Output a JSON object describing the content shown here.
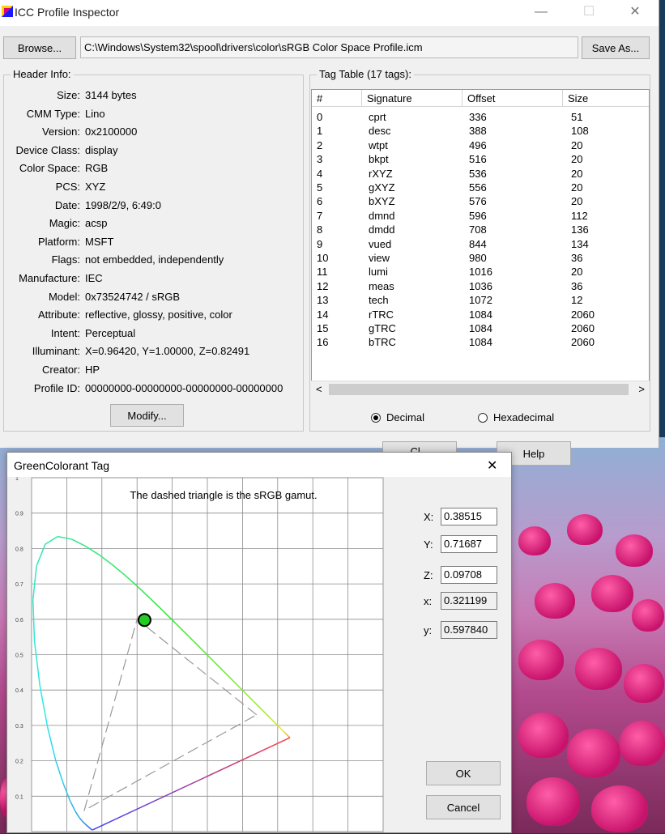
{
  "window": {
    "title": "ICC Profile Inspector",
    "minimize": "—",
    "maximize": "☐",
    "close": "✕"
  },
  "toolbar": {
    "browse_label": "Browse...",
    "path_value": "C:\\Windows\\System32\\spool\\drivers\\color\\sRGB Color Space Profile.icm",
    "save_as_label": "Save As..."
  },
  "header_info": {
    "label": "Header Info:",
    "fields": [
      {
        "key": "Size:",
        "value": "3144 bytes"
      },
      {
        "key": "CMM Type:",
        "value": "Lino"
      },
      {
        "key": "Version:",
        "value": "0x2100000"
      },
      {
        "key": "Device Class:",
        "value": "display"
      },
      {
        "key": "Color Space:",
        "value": "RGB"
      },
      {
        "key": "PCS:",
        "value": "XYZ"
      },
      {
        "key": "Date:",
        "value": "1998/2/9, 6:49:0"
      },
      {
        "key": "Magic:",
        "value": "acsp"
      },
      {
        "key": "Platform:",
        "value": "MSFT"
      },
      {
        "key": "Flags:",
        "value": "not embedded, independently"
      },
      {
        "key": "Manufacture:",
        "value": "IEC"
      },
      {
        "key": "Model:",
        "value": "0x73524742 / sRGB"
      },
      {
        "key": "Attribute:",
        "value": "reflective, glossy, positive, color"
      },
      {
        "key": "Intent:",
        "value": "Perceptual"
      },
      {
        "key": "Illuminant:",
        "value": "X=0.96420, Y=1.00000, Z=0.82491"
      },
      {
        "key": "Creator:",
        "value": "HP"
      },
      {
        "key": "Profile ID:",
        "value": "00000000-00000000-00000000-00000000"
      }
    ],
    "modify_label": "Modify..."
  },
  "tag_table": {
    "label": "Tag Table (17 tags):",
    "columns": [
      "#",
      "Signature",
      "Offset",
      "Size"
    ],
    "rows": [
      [
        "0",
        "cprt",
        "336",
        "51"
      ],
      [
        "1",
        "desc",
        "388",
        "108"
      ],
      [
        "2",
        "wtpt",
        "496",
        "20"
      ],
      [
        "3",
        "bkpt",
        "516",
        "20"
      ],
      [
        "4",
        "rXYZ",
        "536",
        "20"
      ],
      [
        "5",
        "gXYZ",
        "556",
        "20"
      ],
      [
        "6",
        "bXYZ",
        "576",
        "20"
      ],
      [
        "7",
        "dmnd",
        "596",
        "112"
      ],
      [
        "8",
        "dmdd",
        "708",
        "136"
      ],
      [
        "9",
        "vued",
        "844",
        "134"
      ],
      [
        "10",
        "view",
        "980",
        "36"
      ],
      [
        "11",
        "lumi",
        "1016",
        "20"
      ],
      [
        "12",
        "meas",
        "1036",
        "36"
      ],
      [
        "13",
        "tech",
        "1072",
        "12"
      ],
      [
        "14",
        "rTRC",
        "1084",
        "2060"
      ],
      [
        "15",
        "gTRC",
        "1084",
        "2060"
      ],
      [
        "16",
        "bTRC",
        "1084",
        "2060"
      ]
    ],
    "scroll_left": "<",
    "scroll_right": ">",
    "radio_decimal": "Decimal",
    "radio_hex": "Hexadecimal",
    "selected_radio": "decimal"
  },
  "bottom_buttons": {
    "close_partial": "Cl...",
    "help_label": "Help"
  },
  "dialog": {
    "title": "GreenColorant Tag",
    "close": "✕",
    "chart_note": "The dashed triangle is the sRGB gamut.",
    "fields": [
      {
        "key": "X:",
        "value": "0.38515",
        "readonly": false
      },
      {
        "key": "Y:",
        "value": "0.71687",
        "readonly": false
      },
      {
        "key": "Z:",
        "value": "0.09708",
        "readonly": false
      },
      {
        "key": "x:",
        "value": "0.321199",
        "readonly": true
      },
      {
        "key": "y:",
        "value": "0.597840",
        "readonly": true
      }
    ],
    "ok_label": "OK",
    "cancel_label": "Cancel"
  },
  "chart_data": {
    "type": "scatter",
    "title": "The dashed triangle is the sRGB gamut.",
    "xlim": [
      0,
      1
    ],
    "ylim": [
      0,
      1
    ],
    "x_ticks": [
      "0.1",
      "0.2",
      "0.3",
      "0.4",
      "0.5",
      "0.6",
      "0.7",
      "0.8",
      "0.9"
    ],
    "y_ticks": [
      "0.1",
      "0.2",
      "0.3",
      "0.4",
      "0.5",
      "0.6",
      "0.7",
      "0.8",
      "0.9",
      "1"
    ],
    "grid": true,
    "point": {
      "x": 0.321199,
      "y": 0.59784,
      "color": "#22cc22"
    },
    "srgb_gamut": [
      [
        0.64,
        0.33
      ],
      [
        0.3,
        0.6
      ],
      [
        0.15,
        0.06
      ]
    ],
    "spectral_locus": [
      [
        0.1741,
        0.005
      ],
      [
        0.1738,
        0.0049
      ],
      [
        0.1736,
        0.0049
      ],
      [
        0.1733,
        0.0048
      ],
      [
        0.173,
        0.0048
      ],
      [
        0.1726,
        0.0048
      ],
      [
        0.1721,
        0.0048
      ],
      [
        0.1714,
        0.0051
      ],
      [
        0.1703,
        0.0058
      ],
      [
        0.1689,
        0.0069
      ],
      [
        0.1669,
        0.0086
      ],
      [
        0.1644,
        0.0109
      ],
      [
        0.1611,
        0.0138
      ],
      [
        0.1566,
        0.0177
      ],
      [
        0.151,
        0.0227
      ],
      [
        0.144,
        0.0297
      ],
      [
        0.1355,
        0.0399
      ],
      [
        0.1241,
        0.0578
      ],
      [
        0.1096,
        0.0868
      ],
      [
        0.0913,
        0.1327
      ],
      [
        0.0687,
        0.2007
      ],
      [
        0.0454,
        0.295
      ],
      [
        0.0235,
        0.4127
      ],
      [
        0.0082,
        0.5384
      ],
      [
        0.0039,
        0.6548
      ],
      [
        0.0139,
        0.7502
      ],
      [
        0.0389,
        0.812
      ],
      [
        0.0743,
        0.8338
      ],
      [
        0.1142,
        0.8262
      ],
      [
        0.1547,
        0.8059
      ],
      [
        0.1929,
        0.7816
      ],
      [
        0.2296,
        0.7543
      ],
      [
        0.2658,
        0.7243
      ],
      [
        0.3016,
        0.6923
      ],
      [
        0.3373,
        0.6589
      ],
      [
        0.3731,
        0.6245
      ],
      [
        0.4087,
        0.5896
      ],
      [
        0.4441,
        0.5547
      ],
      [
        0.4788,
        0.5202
      ],
      [
        0.5125,
        0.4866
      ],
      [
        0.5448,
        0.4544
      ],
      [
        0.5752,
        0.4242
      ],
      [
        0.6029,
        0.3965
      ],
      [
        0.627,
        0.3725
      ],
      [
        0.6482,
        0.3514
      ],
      [
        0.6658,
        0.334
      ],
      [
        0.6801,
        0.3197
      ],
      [
        0.6915,
        0.3083
      ],
      [
        0.7006,
        0.2993
      ],
      [
        0.7079,
        0.292
      ],
      [
        0.714,
        0.2859
      ],
      [
        0.719,
        0.2809
      ],
      [
        0.723,
        0.277
      ],
      [
        0.726,
        0.274
      ],
      [
        0.7283,
        0.2717
      ],
      [
        0.73,
        0.27
      ],
      [
        0.7311,
        0.2689
      ],
      [
        0.732,
        0.268
      ],
      [
        0.7327,
        0.2673
      ],
      [
        0.7334,
        0.2666
      ],
      [
        0.734,
        0.266
      ],
      [
        0.7344,
        0.2656
      ],
      [
        0.7346,
        0.2654
      ],
      [
        0.7347,
        0.2653
      ]
    ]
  }
}
